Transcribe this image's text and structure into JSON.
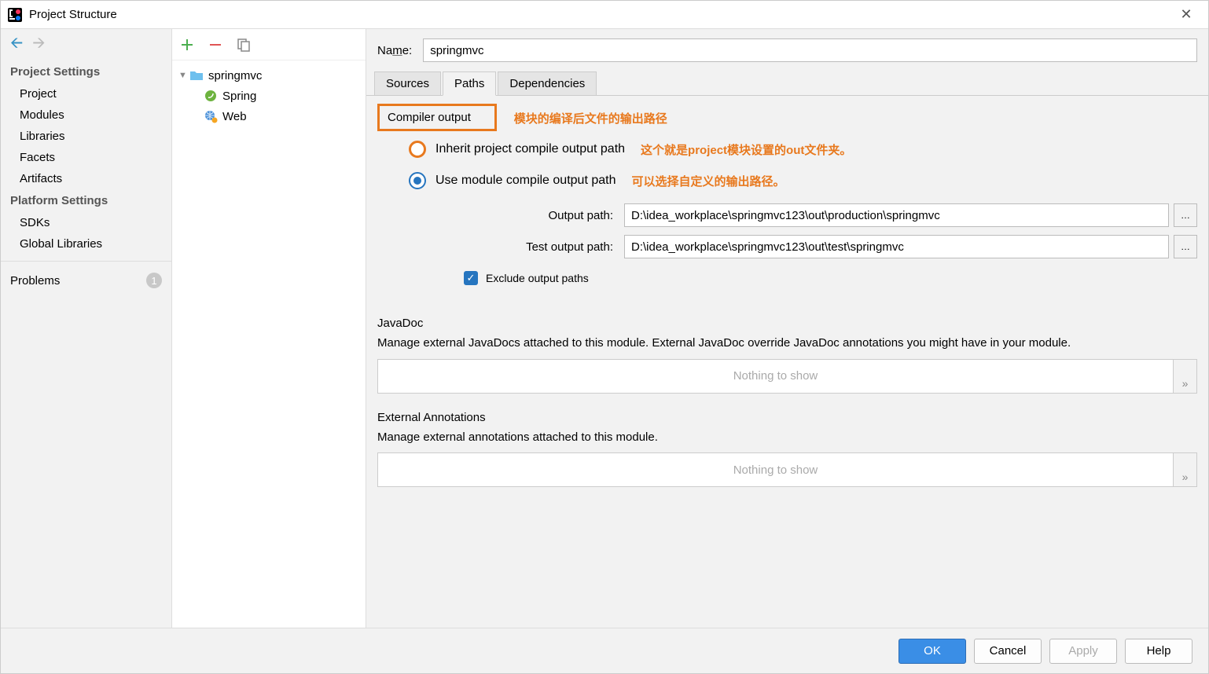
{
  "window": {
    "title": "Project Structure"
  },
  "sidebar": {
    "projectHeading": "Project Settings",
    "projectItems": [
      "Project",
      "Modules",
      "Libraries",
      "Facets",
      "Artifacts"
    ],
    "platformHeading": "Platform Settings",
    "platformItems": [
      "SDKs",
      "Global Libraries"
    ],
    "problems": {
      "label": "Problems",
      "count": "1"
    }
  },
  "tree": {
    "root": "springmvc",
    "children": [
      {
        "icon": "spring",
        "label": "Spring"
      },
      {
        "icon": "web",
        "label": "Web"
      }
    ]
  },
  "main": {
    "nameLabel": "Name:",
    "nameValue": "springmvc",
    "tabs": [
      "Sources",
      "Paths",
      "Dependencies"
    ],
    "activeTab": "Paths",
    "compilerOutput": {
      "title": "Compiler output",
      "anno1": "模块的编译后文件的输出路径",
      "inheritLabel": "Inherit project compile output path",
      "inheritAnno": "这个就是project模块设置的out文件夹。",
      "useModuleLabel": "Use module compile output path",
      "useModuleAnno": "可以选择自定义的输出路径。",
      "outputPathLabel": "Output path:",
      "outputPathValue": "D:\\idea_workplace\\springmvc123\\out\\production\\springmvc",
      "testOutputPathLabel": "Test output path:",
      "testOutputPathValue": "D:\\idea_workplace\\springmvc123\\out\\test\\springmvc",
      "excludeLabel": "Exclude output paths"
    },
    "javadoc": {
      "title": "JavaDoc",
      "desc": "Manage external JavaDocs attached to this module. External JavaDoc override JavaDoc annotations you might have in your module.",
      "placeholder": "Nothing to show"
    },
    "external": {
      "title": "External Annotations",
      "desc": "Manage external annotations attached to this module.",
      "placeholder": "Nothing to show"
    }
  },
  "footer": {
    "ok": "OK",
    "cancel": "Cancel",
    "apply": "Apply",
    "help": "Help"
  }
}
